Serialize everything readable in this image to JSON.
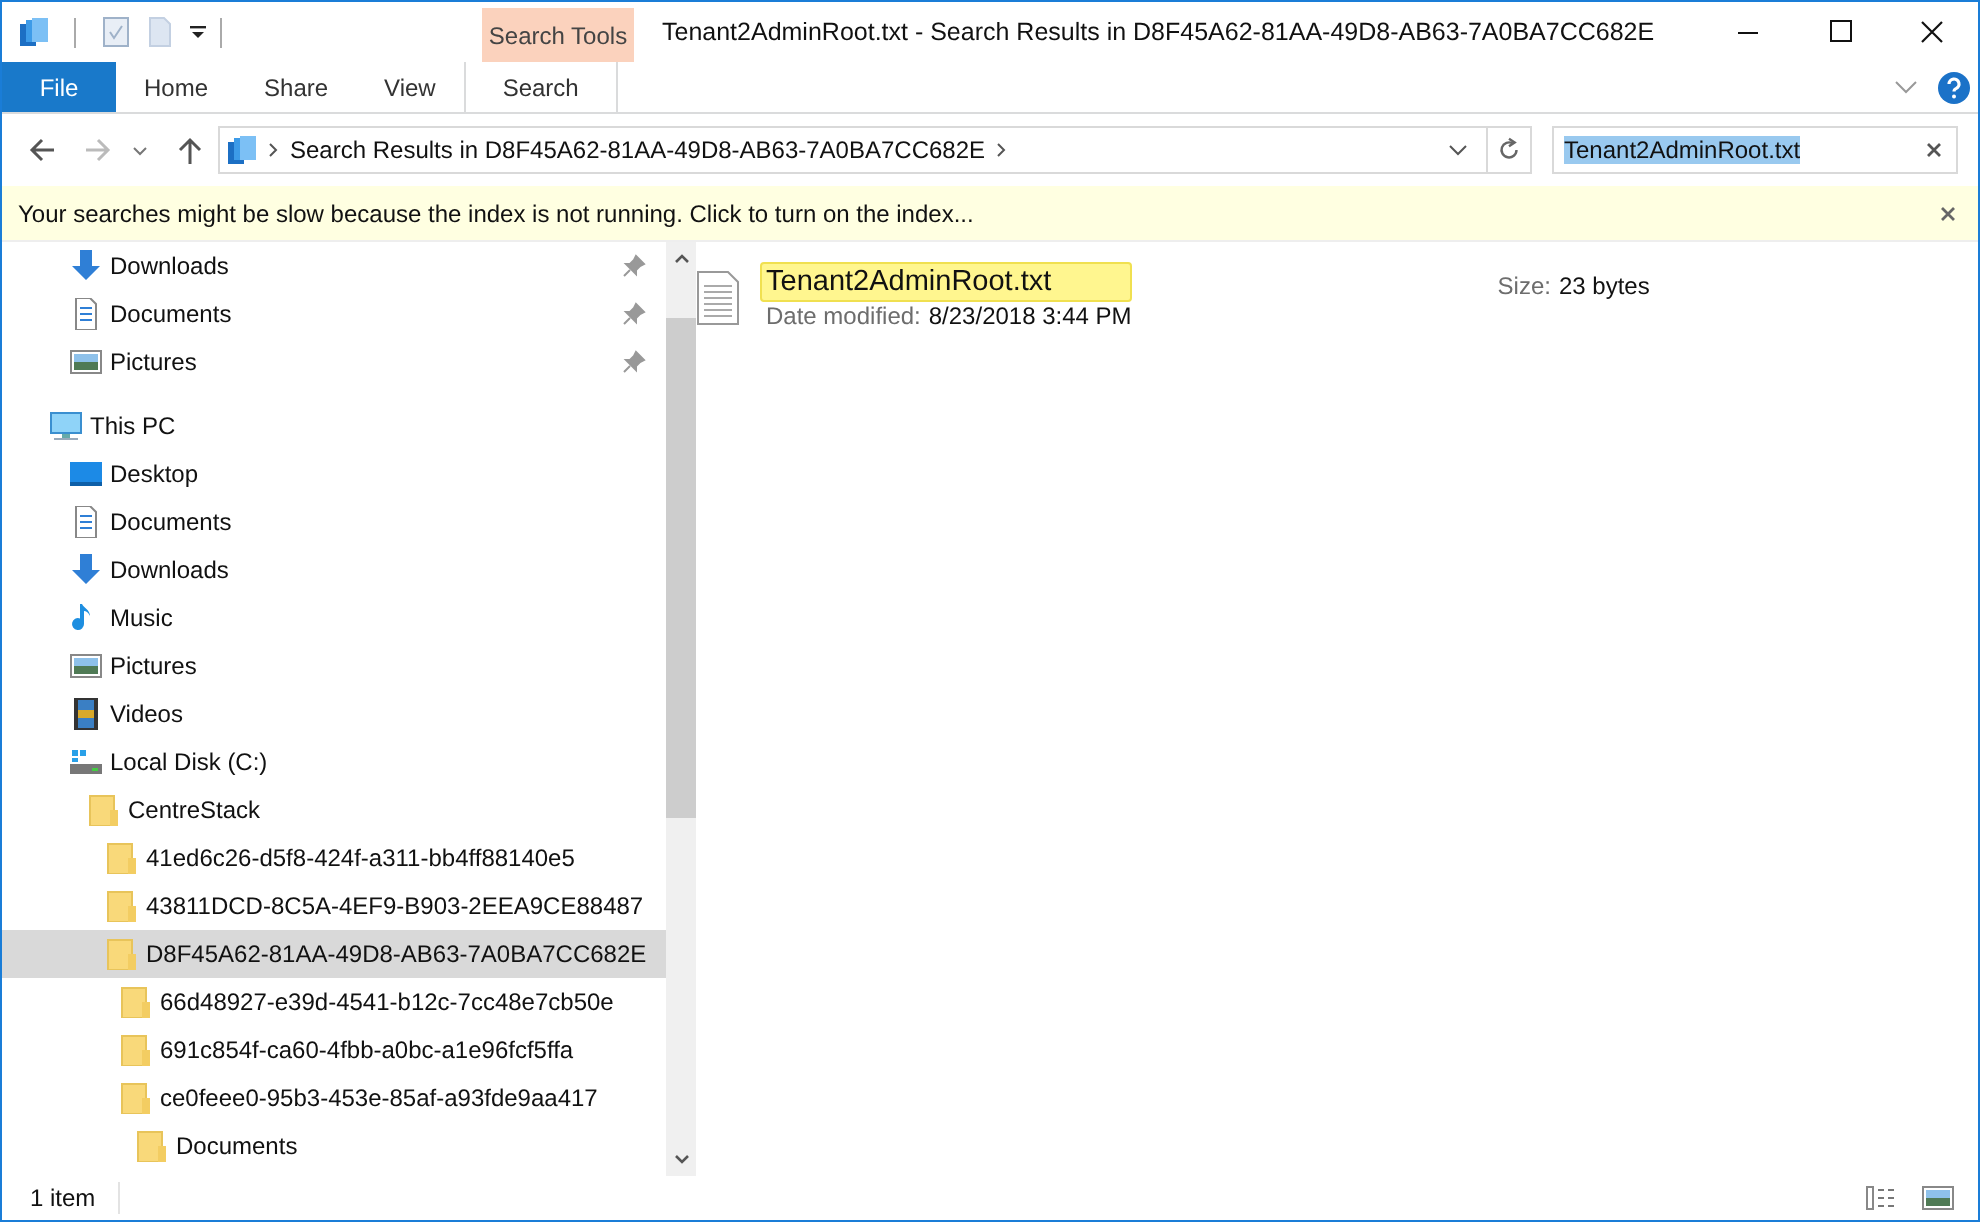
{
  "window": {
    "title": "Tenant2AdminRoot.txt - Search Results in D8F45A62-81AA-49D8-AB63-7A0BA7CC682E"
  },
  "ribbon": {
    "context_group": "Search Tools",
    "tabs": [
      {
        "label": "File",
        "kind": "file",
        "selected": false
      },
      {
        "label": "Home",
        "kind": "normal",
        "selected": false
      },
      {
        "label": "Share",
        "kind": "normal",
        "selected": false
      },
      {
        "label": "View",
        "kind": "normal",
        "selected": false
      },
      {
        "label": "Search",
        "kind": "contextual",
        "selected": true
      }
    ]
  },
  "address_bar": {
    "path": "Search Results in D8F45A62-81AA-49D8-AB63-7A0BA7CC682E"
  },
  "search": {
    "value": "Tenant2AdminRoot.txt",
    "text_selected": true
  },
  "info_bar": {
    "message": "Your searches might be slow because the index is not running.  Click to turn on the index..."
  },
  "navigation": {
    "quick_access": [
      {
        "label": "Downloads",
        "kind": "downloads",
        "pinned": true
      },
      {
        "label": "Documents",
        "kind": "documents",
        "pinned": true
      },
      {
        "label": "Pictures",
        "kind": "pictures",
        "pinned": true
      }
    ],
    "tree": [
      {
        "label": "This PC",
        "kind": "pc",
        "selected": false,
        "children": [
          {
            "label": "Desktop",
            "kind": "desktop",
            "selected": false
          },
          {
            "label": "Documents",
            "kind": "documents",
            "selected": false
          },
          {
            "label": "Downloads",
            "kind": "downloads",
            "selected": false
          },
          {
            "label": "Music",
            "kind": "music",
            "selected": false
          },
          {
            "label": "Pictures",
            "kind": "pictures",
            "selected": false
          },
          {
            "label": "Videos",
            "kind": "videos",
            "selected": false
          },
          {
            "label": "Local Disk (C:)",
            "kind": "disk",
            "selected": false,
            "children": [
              {
                "label": "CentreStack",
                "kind": "folder",
                "selected": false,
                "children": [
                  {
                    "label": "41ed6c26-d5f8-424f-a311-bb4ff88140e5",
                    "kind": "folder",
                    "selected": false
                  },
                  {
                    "label": "43811DCD-8C5A-4EF9-B903-2EEA9CE88487",
                    "kind": "folder",
                    "selected": false
                  },
                  {
                    "label": "D8F45A62-81AA-49D8-AB63-7A0BA7CC682E",
                    "kind": "folder",
                    "selected": true,
                    "children": [
                      {
                        "label": "66d48927-e39d-4541-b12c-7cc48e7cb50e",
                        "kind": "folder",
                        "selected": false
                      },
                      {
                        "label": "691c854f-ca60-4fbb-a0bc-a1e96fcf5ffa",
                        "kind": "folder",
                        "selected": false
                      },
                      {
                        "label": "ce0feee0-95b3-453e-85af-a93fde9aa417",
                        "kind": "folder",
                        "selected": false,
                        "children": [
                          {
                            "label": "Documents",
                            "kind": "folder",
                            "selected": false
                          }
                        ]
                      }
                    ]
                  }
                ]
              }
            ]
          }
        ]
      }
    ]
  },
  "results": [
    {
      "name": "Tenant2AdminRoot.txt",
      "match_highlighted": true,
      "date_label": "Date modified:",
      "date": "8/23/2018 3:44 PM",
      "size_label": "Size:",
      "size": "23 bytes"
    }
  ],
  "status_bar": {
    "item_count": "1 item"
  }
}
